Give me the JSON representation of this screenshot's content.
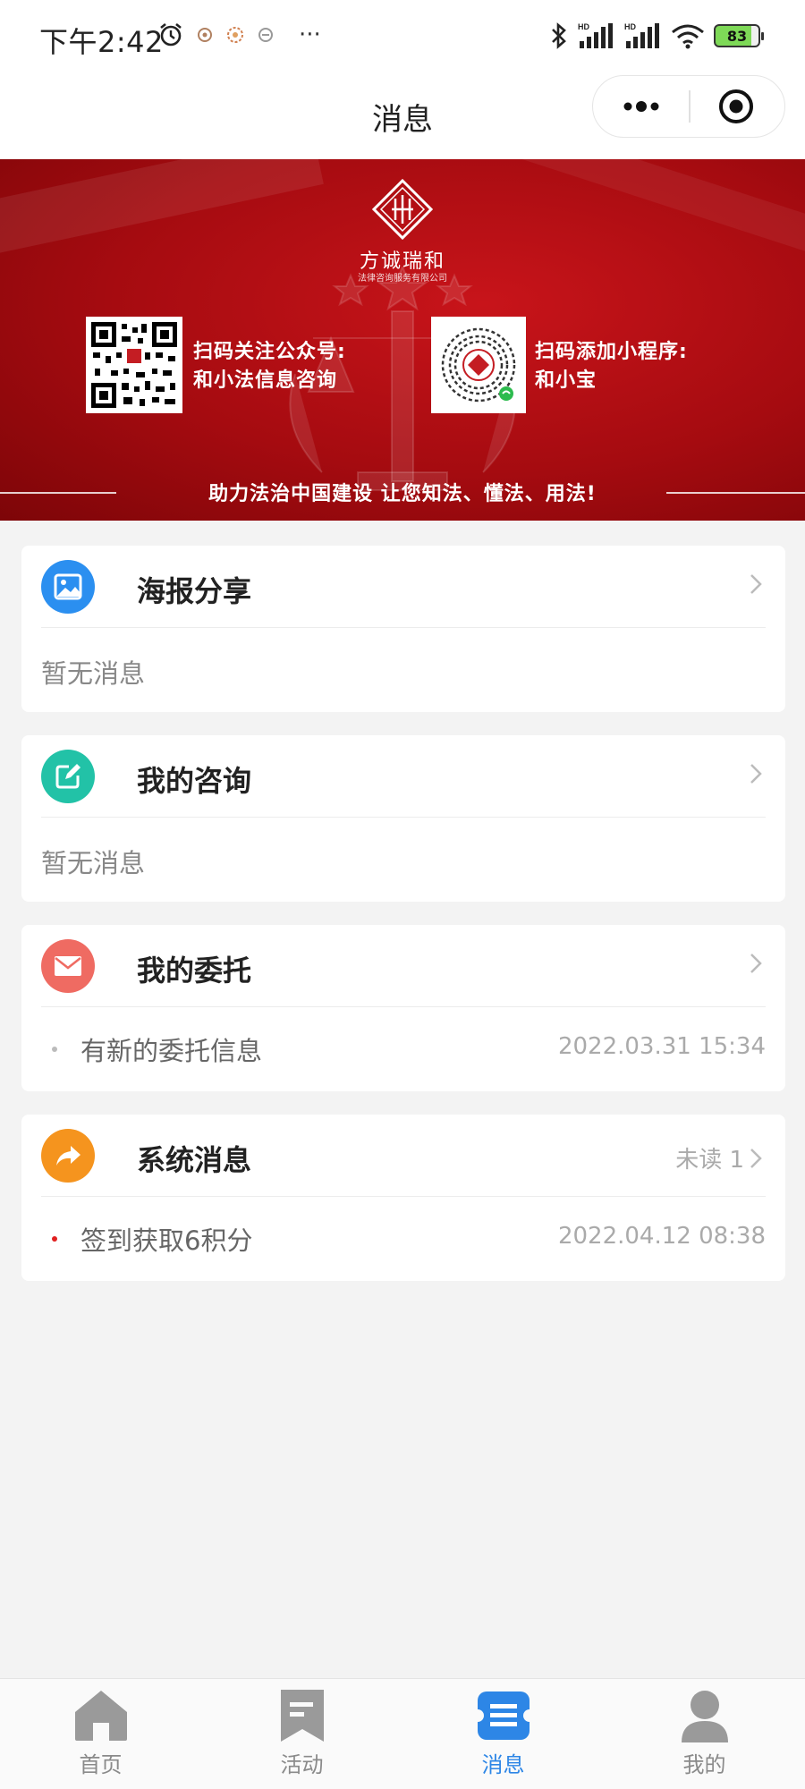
{
  "status_bar": {
    "time": "下午2:42",
    "more": "···",
    "battery": "83"
  },
  "nav": {
    "title": "消息",
    "more_icon": "more-dots-icon",
    "close_icon": "target-close-icon"
  },
  "banner": {
    "brand": "方诚瑞和",
    "brand_sub": "法律咨询服务有限公司",
    "qr_left_line1": "扫码关注公众号:",
    "qr_left_line2": "和小法信息咨询",
    "qr_right_line1": "扫码添加小程序:",
    "qr_right_line2": "和小宝",
    "slogan": "助力法治中国建设 让您知法、懂法、用法!"
  },
  "cards": [
    {
      "title": "海报分享",
      "icon": "image-icon",
      "color": "#2b8ff0",
      "empty": "暂无消息"
    },
    {
      "title": "我的咨询",
      "icon": "edit-icon",
      "color": "#22c2a7",
      "empty": "暂无消息"
    },
    {
      "title": "我的委托",
      "icon": "mail-icon",
      "color": "#ef6b62",
      "message": "有新的委托信息",
      "time": "2022.03.31 15:34",
      "dot_color": "#bbbbbb"
    },
    {
      "title": "系统消息",
      "icon": "share-arrow-icon",
      "color": "#f5941e",
      "unread": "未读 1",
      "message": "签到获取6积分",
      "time": "2022.04.12 08:38",
      "dot_color": "#e02020"
    }
  ],
  "tabs": [
    {
      "label": "首页",
      "icon": "home-icon",
      "active": false
    },
    {
      "label": "活动",
      "icon": "bookmark-icon",
      "active": false
    },
    {
      "label": "消息",
      "icon": "message-icon",
      "active": true
    },
    {
      "label": "我的",
      "icon": "user-icon",
      "active": false
    }
  ],
  "colors": {
    "active_tab": "#2d86e6",
    "inactive_tab": "#8a8a8a",
    "banner_red": "#b50d13"
  }
}
